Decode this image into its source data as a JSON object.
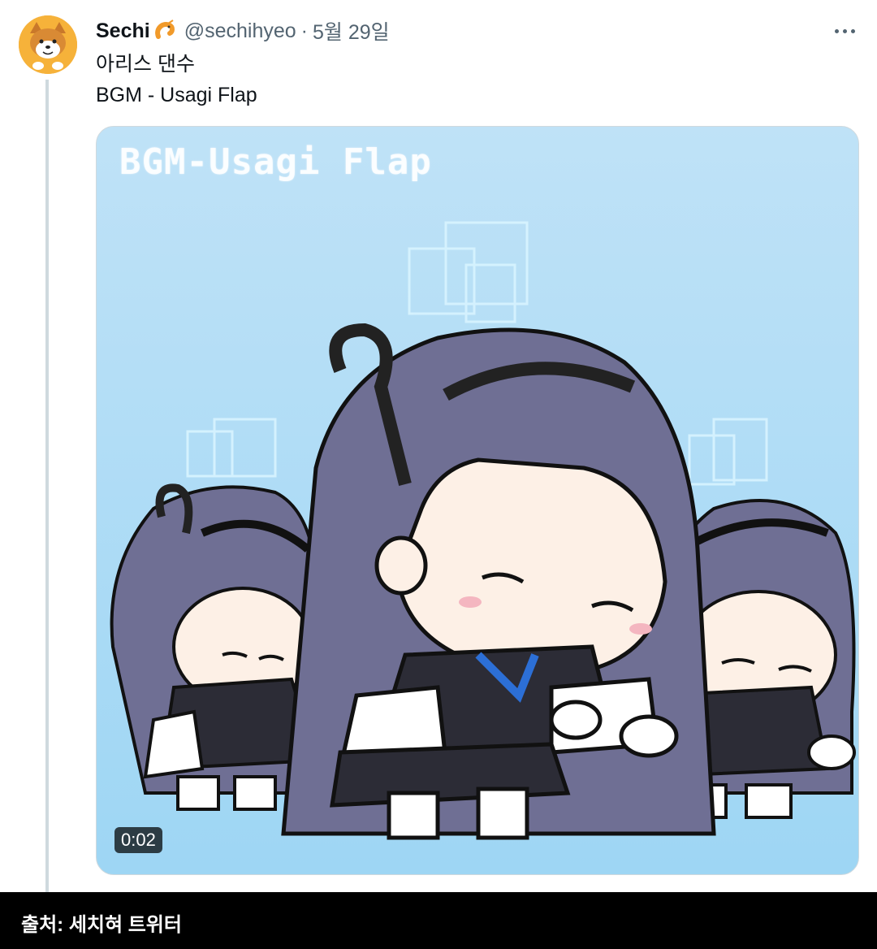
{
  "tweet": {
    "display_name": "Sechi",
    "handle": "@sechihyeo",
    "separator": "·",
    "date": "5월 29일",
    "text_lines": [
      "아리스 댄수",
      "BGM - Usagi Flap"
    ],
    "badge_icon": "shrimp-emoji",
    "more_icon": "more-horizontal-icon"
  },
  "media": {
    "overlay_title": "BGM-Usagi Flap",
    "duration": "0:02"
  },
  "caption": {
    "text": "출처: 세치혀 트위터"
  },
  "colors": {
    "text_primary": "#0f1419",
    "text_secondary": "#536471",
    "border": "#cfd9de",
    "media_bg": "#a9dcf6",
    "hair": "#6f6f94",
    "caption_bg": "#000000"
  }
}
